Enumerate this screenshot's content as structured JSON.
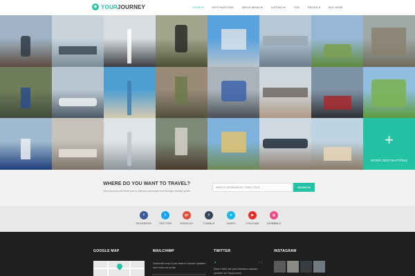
{
  "header": {
    "logo_prefix": "YOUR",
    "logo_suffix": "JOURNEY",
    "nav": [
      {
        "label": "HOME ▾",
        "active": true
      },
      {
        "label": "DESTINATIONS",
        "active": false
      },
      {
        "label": "MEGA MENU ▾",
        "active": false
      },
      {
        "label": "LISTING ▾",
        "active": false
      },
      {
        "label": "TOS",
        "active": false
      },
      {
        "label": "PAGES ▾",
        "active": false
      },
      {
        "label": "BUY NOW",
        "active": false
      }
    ]
  },
  "grid": {
    "more_label": "MORE DESTINATIONS",
    "tiles": [
      {
        "top": "#9fb3c4",
        "bottom": "#5b4a3f",
        "obj": "#2f3b45"
      },
      {
        "top": "#c8d3dc",
        "bottom": "#7a8d99",
        "obj": "#3e4a52"
      },
      {
        "top": "#d9dde0",
        "bottom": "#3b3d40",
        "obj": "#ffffff"
      },
      {
        "top": "#a3a58c",
        "bottom": "#4b5135",
        "obj": "#2c2a26"
      },
      {
        "top": "#5aa2de",
        "bottom": "#b8c4cf",
        "obj": "#d8e2ea"
      },
      {
        "top": "#b6c7d6",
        "bottom": "#6c7f8b",
        "obj": "#9aa8b2"
      },
      {
        "top": "#97b7d6",
        "bottom": "#5f8a3c",
        "obj": "#7ba04f"
      },
      {
        "top": "#9fa9a7",
        "bottom": "#6f6a5b",
        "obj": "#8a8170"
      },
      {
        "top": "#6f7e5a",
        "bottom": "#3f4a3a",
        "obj": "#2b4d8a"
      },
      {
        "top": "#b9c6d2",
        "bottom": "#4c5a66",
        "obj": "#eef2f4"
      },
      {
        "top": "#4e9fd1",
        "bottom": "#d6c9ae",
        "obj": "#3f7fae"
      },
      {
        "top": "#9a8a78",
        "bottom": "#51503c",
        "obj": "#6c7a4a"
      },
      {
        "top": "#a9b3bb",
        "bottom": "#4a4f55",
        "obj": "#3d63a8"
      },
      {
        "top": "#cfd6dc",
        "bottom": "#b09a86",
        "obj": "#6f6a66"
      },
      {
        "top": "#7f93a6",
        "bottom": "#2e3135",
        "obj": "#a6292e"
      },
      {
        "top": "#8fbede",
        "bottom": "#5f9a3b",
        "obj": "#7bb24f"
      },
      {
        "top": "#9fbad1",
        "bottom": "#1f3f7a",
        "obj": "#e9eef2"
      },
      {
        "top": "#c6c2ba",
        "bottom": "#7d7467",
        "obj": "#e8e4dc"
      },
      {
        "top": "#dfe4e7",
        "bottom": "#8d9599",
        "obj": "#bcc4c9"
      },
      {
        "top": "#7c8a78",
        "bottom": "#4a3a2c",
        "obj": "#d6d1c8"
      },
      {
        "top": "#7fb3de",
        "bottom": "#6d8a55",
        "obj": "#e0c270"
      },
      {
        "top": "#cfd9e2",
        "bottom": "#8a7c6c",
        "obj": "#1f2a3a"
      },
      {
        "top": "#bfd4e2",
        "bottom": "#8c7b66",
        "obj": "#e8d6b8"
      }
    ]
  },
  "search": {
    "title": "WHERE DO YOU WANT TO TRAVEL?",
    "subtitle": "Your journey will lead you to famous domestic and foreign beauty spots.",
    "placeholder": "Search destinations, hotel, food, ...",
    "button": "SEARCH"
  },
  "social": [
    {
      "label": "FACEBOOK",
      "glyph": "f",
      "color": "#3b5998"
    },
    {
      "label": "TWITTER",
      "glyph": "t",
      "color": "#1da1f2"
    },
    {
      "label": "GOOGLE+",
      "glyph": "g+",
      "color": "#dd4b39"
    },
    {
      "label": "TUMBLR",
      "glyph": "t",
      "color": "#35465c"
    },
    {
      "label": "VIMEO",
      "glyph": "v",
      "color": "#1ab7ea"
    },
    {
      "label": "YOUTUBE",
      "glyph": "▶",
      "color": "#e52d27"
    },
    {
      "label": "DRIBBBLE",
      "glyph": "◎",
      "color": "#ea4c89"
    }
  ],
  "footer": {
    "google_map": "GOOGLE MAP",
    "mailchimp": "MAILCHIMP",
    "mailchimp_text": "Subscribe now if you want to receive updates and news via email:",
    "twitter": "TWITTER",
    "tweet_text": "Dear Folks! We just released massive updates for Yourjourney",
    "instagram": "INSTAGRAM",
    "insta_colors": [
      "#5a5a5a",
      "#8a8a86",
      "#3a3d40",
      "#6e7a80"
    ]
  },
  "colors": {
    "accent": "#24c2a4"
  }
}
